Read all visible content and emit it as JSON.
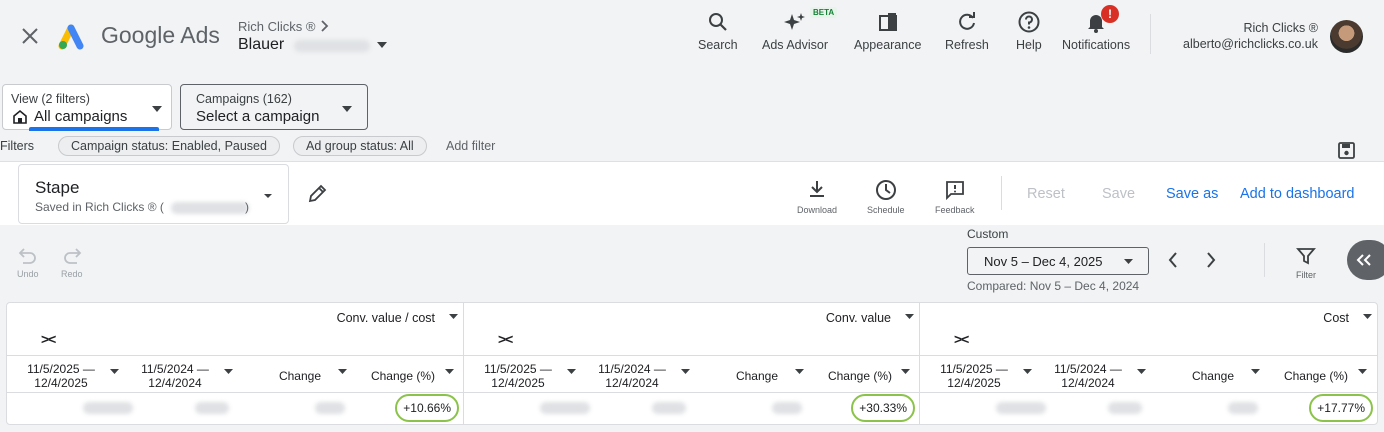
{
  "header": {
    "product_name": "Google Ads",
    "account_breadcrumb": "Rich Clicks ®",
    "account_name": "Blauer",
    "nav": [
      {
        "label": "Search",
        "icon": "search-icon"
      },
      {
        "label": "Ads Advisor",
        "icon": "sparkle-icon",
        "badge": "BETA"
      },
      {
        "label": "Appearance",
        "icon": "appearance-icon"
      },
      {
        "label": "Refresh",
        "icon": "refresh-icon"
      },
      {
        "label": "Help",
        "icon": "help-icon"
      },
      {
        "label": "Notifications",
        "icon": "bell-icon",
        "alert": "!"
      }
    ],
    "user_name": "Rich Clicks ®",
    "user_email": "alberto@richclicks.co.uk"
  },
  "filters": {
    "view_label": "View (2 filters)",
    "view_value": "All campaigns",
    "campaigns_label": "Campaigns (162)",
    "campaigns_value": "Select a campaign",
    "filters_label": "Filters",
    "chips": [
      "Campaign status: Enabled, Paused",
      "Ad group status: All"
    ],
    "add_filter": "Add filter"
  },
  "report": {
    "name": "Stape",
    "saved_in_prefix": "Saved in Rich Clicks ® (",
    "saved_in_suffix": ")",
    "download": "Download",
    "schedule": "Schedule",
    "feedback": "Feedback",
    "reset": "Reset",
    "save": "Save",
    "save_as": "Save as",
    "add_to_dashboard": "Add to dashboard"
  },
  "toolbar": {
    "undo": "Undo",
    "redo": "Redo",
    "date_label": "Custom",
    "date_range": "Nov 5 – Dec 4, 2025",
    "compared": "Compared: Nov 5 – Dec 4, 2024",
    "filter": "Filter"
  },
  "table": {
    "expand_symbol": "><",
    "groups": [
      {
        "metric": "Conv. value / cost",
        "col1_line1": "11/5/2025 —",
        "col1_line2": "12/4/2025",
        "col2_line1": "11/5/2024 —",
        "col2_line2": "12/4/2024",
        "change": "Change",
        "change_pct": "Change (%)",
        "value_pct": "+10.66%"
      },
      {
        "metric": "Conv. value",
        "col1_line1": "11/5/2025 —",
        "col1_line2": "12/4/2025",
        "col2_line1": "11/5/2024 —",
        "col2_line2": "12/4/2024",
        "change": "Change",
        "change_pct": "Change (%)",
        "value_pct": "+30.33%"
      },
      {
        "metric": "Cost",
        "col1_line1": "11/5/2025 —",
        "col1_line2": "12/4/2025",
        "col2_line1": "11/5/2024 —",
        "col2_line2": "12/4/2024",
        "change": "Change",
        "change_pct": "Change (%)",
        "value_pct": "+17.77%"
      }
    ]
  },
  "colors": {
    "accent": "#1a73e8",
    "highlight": "#8bc34a",
    "alert": "#d93025"
  }
}
